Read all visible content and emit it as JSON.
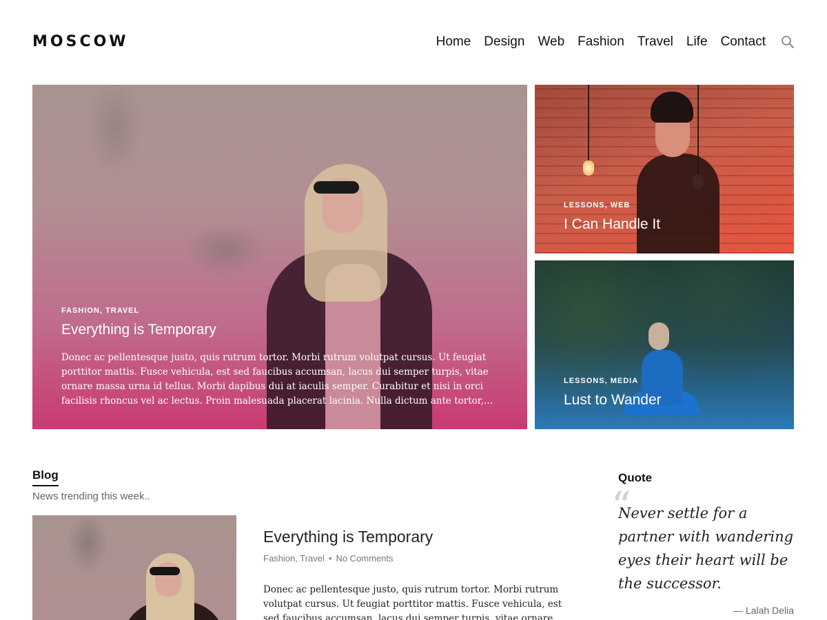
{
  "site": {
    "logo": "MOSCOW"
  },
  "nav": {
    "items": [
      "Home",
      "Design",
      "Web",
      "Fashion",
      "Travel",
      "Life",
      "Contact"
    ],
    "search_icon": "search-icon"
  },
  "featured": {
    "main": {
      "categories": [
        "Fashion",
        "Travel"
      ],
      "title": "Everything is Temporary",
      "excerpt": "Donec ac pellentesque justo, quis rutrum tortor. Morbi rutrum volutpat cursus. Ut feugiat porttitor mattis. Fusce vehicula, est sed faucibus accumsan, lacus dui semper turpis, vitae ornare massa urna id tellus. Morbi dapibus dui at iaculis semper. Curabitur et nisi in orci facilisis rhoncus vel ac lectus. Proin malesuada placerat lacinia. Nulla dictum ante tortor,..."
    },
    "top": {
      "categories": [
        "Lessons",
        "Web"
      ],
      "title": "I Can Handle It"
    },
    "bottom": {
      "categories": [
        "Lessons",
        "Media"
      ],
      "title": "Lust to Wander"
    }
  },
  "blog": {
    "title": "Blog",
    "subtitle": "News trending this week..",
    "post": {
      "title": "Everything is Temporary",
      "categories": [
        "Fashion",
        "Travel"
      ],
      "comments": "No Comments",
      "excerpt": "Donec ac pellentesque justo, quis rutrum tortor. Morbi rutrum volutpat cursus. Ut feugiat porttitor mattis. Fusce vehicula, est sed faucibus accumsan, lacus dui semper turpis, vitae ornare massa"
    }
  },
  "quote": {
    "heading": "Quote",
    "text": "Never settle for a partner with wandering eyes their heart will be the successor.",
    "author": "— Lalah Delia"
  },
  "colors": {
    "accent_pink": "#c93a72",
    "accent_red": "#e8543e",
    "accent_blue": "#2c7ab6"
  }
}
